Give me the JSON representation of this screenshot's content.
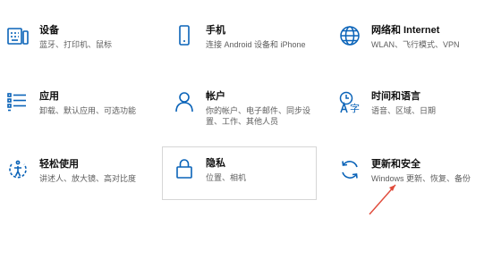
{
  "accent_color": "#0a63b8",
  "annotation_color": "#e04a3a",
  "tiles": [
    {
      "icon": "keyboard-icon",
      "title": "设备",
      "desc_lines": [
        "蓝牙、打印机、鼠标"
      ]
    },
    {
      "icon": "phone-icon",
      "title": "手机",
      "desc_lines": [
        "连接 Android 设备和 iPhone"
      ]
    },
    {
      "icon": "globe-icon",
      "title": "网络和 Internet",
      "desc_lines": [
        "WLAN、飞行模式、VPN"
      ]
    },
    {
      "icon": "apps-list-icon",
      "title": "应用",
      "desc_lines": [
        "卸载、默认应用、可选功能"
      ]
    },
    {
      "icon": "person-icon",
      "title": "帐户",
      "desc_lines": [
        "你的帐户、电子邮件、同步设",
        "置、工作、其他人员"
      ]
    },
    {
      "icon": "time-language-icon",
      "title": "时间和语言",
      "desc_lines": [
        "语音、区域、日期"
      ]
    },
    {
      "icon": "ease-of-access-icon",
      "title": "轻松使用",
      "desc_lines": [
        "讲述人、放大镜、高对比度"
      ]
    },
    {
      "icon": "lock-icon",
      "title": "隐私",
      "desc_lines": [
        "位置、相机"
      ]
    },
    {
      "icon": "sync-icon",
      "title": "更新和安全",
      "desc_lines": [
        "Windows 更新、恢复、备份"
      ]
    }
  ]
}
